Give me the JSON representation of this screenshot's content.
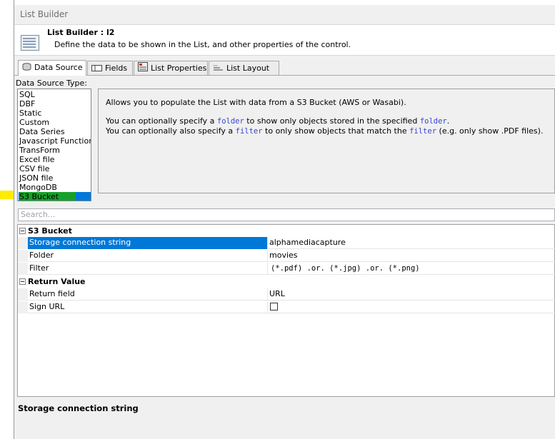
{
  "window": {
    "title": "List Builder"
  },
  "header": {
    "title": "List Builder : l2",
    "subtitle": "Define the data to be shown in the List, and other properties of the control."
  },
  "tabs": [
    {
      "label": "Data Source",
      "icon": "database-icon",
      "active": true
    },
    {
      "label": "Fields",
      "icon": "fields-icon",
      "active": false
    },
    {
      "label": "List Properties",
      "icon": "properties-icon",
      "active": false
    },
    {
      "label": "List Layout",
      "icon": "layout-icon",
      "active": false
    }
  ],
  "data_source": {
    "label": "Data Source Type:",
    "items": [
      "SQL",
      "DBF",
      "Static",
      "Custom",
      "Data Series",
      "Javascript Function",
      "TransForm",
      "Excel file",
      "CSV file",
      "JSON file",
      "MongoDB",
      "S3 Bucket"
    ],
    "selected": "S3 Bucket"
  },
  "description": {
    "line1": "Allows you to populate the List with data from a S3 Bucket (AWS or Wasabi).",
    "line2": {
      "pre": "You can optionally specify a ",
      "code1": "folder",
      "mid": " to show only objects stored in the specified ",
      "code2": "folder",
      "post": "."
    },
    "line3": {
      "pre": "You can optionally also specify a ",
      "code1": "filter",
      "mid": " to only show objects that match the ",
      "code2": "filter",
      "post": " (e.g. only show .PDF files)."
    }
  },
  "search": {
    "placeholder": "Search..."
  },
  "properties": {
    "categories": [
      {
        "name": "S3 Bucket",
        "rows": [
          {
            "name": "Storage connection string",
            "value": "alphamediacapture"
          },
          {
            "name": "Folder",
            "value": "movies"
          },
          {
            "name": "Filter",
            "value": "(*.pdf) .or. (*.jpg) .or. (*.png)"
          }
        ]
      },
      {
        "name": "Return Value",
        "rows": [
          {
            "name": "Return field",
            "value": "URL"
          },
          {
            "name": "Sign URL",
            "value": ""
          }
        ]
      }
    ]
  },
  "help": {
    "title": "Storage connection string"
  },
  "colors": {
    "selection": "#0078d7",
    "highlight_green": "#16a02a",
    "highlight_yellow": "#ffec00",
    "code_blue": "#3b43d6"
  }
}
